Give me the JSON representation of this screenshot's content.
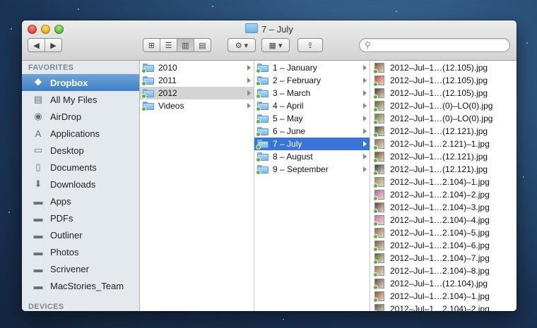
{
  "window": {
    "title": "7 – July",
    "search_placeholder": ""
  },
  "toolbar": {
    "back_icon": "back-arrow-icon",
    "forward_icon": "forward-arrow-icon",
    "view_modes": [
      "icon-view",
      "list-view",
      "column-view",
      "cover-flow-view"
    ],
    "active_view": "column-view"
  },
  "sidebar": {
    "favorites_heading": "FAVORITES",
    "devices_heading": "DEVICES",
    "items": [
      {
        "label": "Dropbox",
        "icon": "dropbox-icon",
        "selected": true
      },
      {
        "label": "All My Files",
        "icon": "all-files-icon"
      },
      {
        "label": "AirDrop",
        "icon": "airdrop-icon"
      },
      {
        "label": "Applications",
        "icon": "applications-icon"
      },
      {
        "label": "Desktop",
        "icon": "desktop-icon"
      },
      {
        "label": "Documents",
        "icon": "documents-icon"
      },
      {
        "label": "Downloads",
        "icon": "downloads-icon"
      },
      {
        "label": "Apps",
        "icon": "folder-icon"
      },
      {
        "label": "PDFs",
        "icon": "folder-icon"
      },
      {
        "label": "Outliner",
        "icon": "folder-icon"
      },
      {
        "label": "Photos",
        "icon": "folder-icon"
      },
      {
        "label": "Scrivener",
        "icon": "folder-icon"
      },
      {
        "label": "MacStories_Team",
        "icon": "folder-icon"
      }
    ]
  },
  "columns": {
    "years": [
      "2010",
      "2011",
      "2012",
      "Videos"
    ],
    "months": [
      "1 – January",
      "2 – February",
      "3 – March",
      "4 – April",
      "5 – May",
      "6 – June",
      "7 – July",
      "8 – August",
      "9 – September"
    ],
    "files": [
      "2012–Jul–1…(12.105).jpg",
      "2012–Jul–1…(12.105).jpg",
      "2012–Jul–1…(12.105).jpg",
      "2012–Jul–1…(0)–LO(0).jpg",
      "2012–Jul–1…(0)–LO(0).jpg",
      "2012–Jul–1…(12.121).jpg",
      "2012–Jul–1…2.121)–1.jpg",
      "2012–Jul–1…(12.121).jpg",
      "2012–Jul–1…(12.121).jpg",
      "2012–Jul–1…2.104)–1.jpg",
      "2012–Jul–1…2.104)–2.jpg",
      "2012–Jul–1…2.104)–3.jpg",
      "2012–Jul–1…2.104)–4.jpg",
      "2012–Jul–1…2.104)–5.jpg",
      "2012–Jul–1…2.104)–6.jpg",
      "2012–Jul–1…2.104)–7.jpg",
      "2012–Jul–1…2.104)–8.jpg",
      "2012–Jul–1…(12.104).jpg",
      "2012–Jul–1…2.104)–1.jpg",
      "2012–Jul–1…2.104)–2.jpg"
    ],
    "thumb_colors": [
      "#7a5a3a",
      "#c24848",
      "#4b3a2e",
      "#5a6a2e",
      "#6a7a3a",
      "#4c4e2c",
      "#8a7050",
      "#6b4a2a",
      "#3a3a30",
      "#9a8a60",
      "#c060a0",
      "#5a4030",
      "#d070b0",
      "#8a6a4a",
      "#7a5a40",
      "#4a6a30",
      "#9a7a58",
      "#6a4a3a",
      "#8a5a3a",
      "#5a5a48"
    ]
  },
  "colors": {
    "selection_blue": "#3875d7",
    "sidebar_selection": "#4a86cb",
    "sidebar_bg": "#e4e9ee"
  }
}
